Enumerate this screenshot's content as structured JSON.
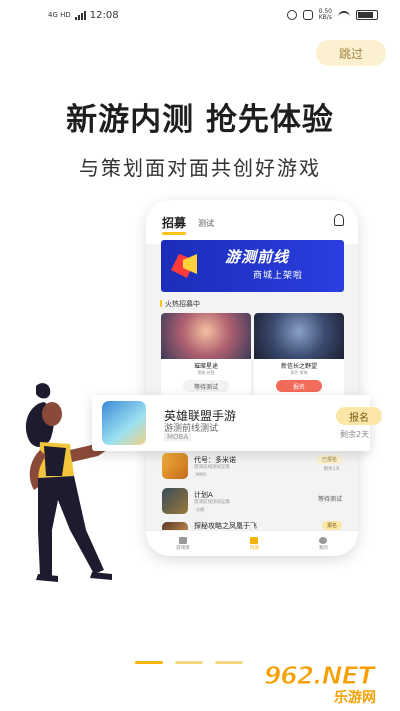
{
  "status_bar": {
    "network": "4G HD",
    "time": "12:08",
    "speed_value": "0.50",
    "speed_unit": "KB/s"
  },
  "skip_label": "跳过",
  "headline": "新游内测 抢先体验",
  "subline": "与策划面对面共创好游戏",
  "phone": {
    "tabs": [
      "招募",
      "测试"
    ],
    "banner_title": "游测前线",
    "banner_subtitle": "商城上架啦",
    "section_title": "火热招募中",
    "cards": [
      {
        "title": "璀璨星途",
        "tags": "策略  经营",
        "button": "等待测试",
        "button_color": "#f2f2f2",
        "text_color": "#555"
      },
      {
        "title": "新信长之野望",
        "tags": "角色  策略",
        "button": "报名",
        "button_color": "#f36b5a",
        "text_color": "#ffffff"
      }
    ],
    "rows": [
      {
        "title": "代号：多米诺",
        "sub": "游测前线测试征集",
        "tag": "MMO",
        "status": "已报名",
        "status_sub": "剩余1天"
      },
      {
        "title": "计划A",
        "sub": "游测前线测试征集",
        "tag": "卡牌",
        "status": "等待测试"
      },
      {
        "title": "探秘攻略之凤凰于飞",
        "status": "报名"
      }
    ],
    "nav": [
      {
        "label": "游戏库",
        "active": false
      },
      {
        "label": "内测",
        "active": true
      },
      {
        "label": "我的",
        "active": false
      }
    ]
  },
  "popup": {
    "title": "英雄联盟手游",
    "subtitle": "游测前线测试",
    "tag": "MOBA",
    "button": "报名",
    "remaining": "剩余2天"
  },
  "logo": {
    "main": "962.NET",
    "sub": "乐游网"
  },
  "colors": {
    "accent": "#ffc21b",
    "skip_bg": "#fbf0cf",
    "banner": "#1b2db8",
    "logo": "#f6a000"
  }
}
